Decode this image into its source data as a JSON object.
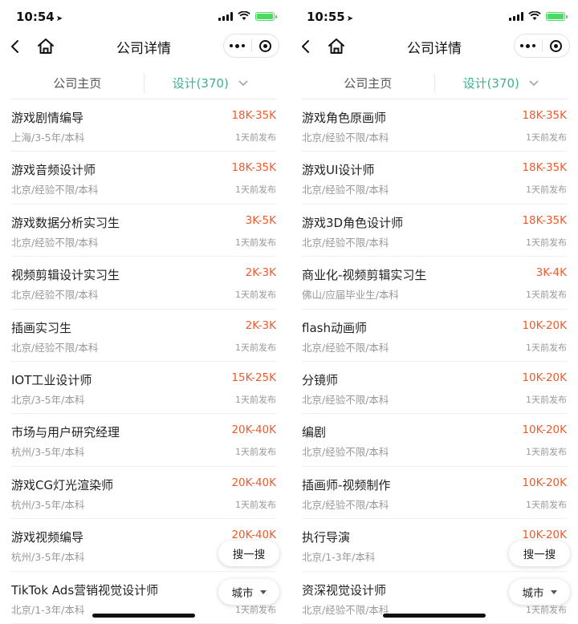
{
  "screens": [
    {
      "status": {
        "time": "10:54"
      },
      "nav": {
        "title": "公司详情"
      },
      "tabs": {
        "home": "公司主页",
        "category": "设计(370)"
      },
      "jobs": [
        {
          "title": "游戏剧情编导",
          "salary": "18K-35K",
          "meta": "上海/3-5年/本科",
          "posted": "1天前发布"
        },
        {
          "title": "游戏音频设计师",
          "salary": "18K-35K",
          "meta": "北京/经验不限/本科",
          "posted": "1天前发布"
        },
        {
          "title": "游戏数据分析实习生",
          "salary": "3K-5K",
          "meta": "北京/经验不限/本科",
          "posted": "1天前发布"
        },
        {
          "title": "视频剪辑设计实习生",
          "salary": "2K-3K",
          "meta": "北京/经验不限/本科",
          "posted": "1天前发布"
        },
        {
          "title": "插画实习生",
          "salary": "2K-3K",
          "meta": "北京/经验不限/本科",
          "posted": "1天前发布"
        },
        {
          "title": "IOT工业设计师",
          "salary": "15K-25K",
          "meta": "北京/3-5年/本科",
          "posted": "1天前发布"
        },
        {
          "title": "市场与用户研究经理",
          "salary": "20K-40K",
          "meta": "杭州/3-5年/本科",
          "posted": "1天前发布"
        },
        {
          "title": "游戏CG灯光渲染师",
          "salary": "20K-40K",
          "meta": "杭州/3-5年/本科",
          "posted": "1天前发布"
        },
        {
          "title": "游戏视频编导",
          "salary": "20K-40K",
          "meta": "杭州/3-5年/本科",
          "posted": ""
        },
        {
          "title": "TikTok Ads营销视觉设计师",
          "salary": "",
          "meta": "北京/1-3年/本科",
          "posted": "1天前发布"
        }
      ],
      "buttons": {
        "search": "搜一搜",
        "city": "城市"
      }
    },
    {
      "status": {
        "time": "10:55"
      },
      "nav": {
        "title": "公司详情"
      },
      "tabs": {
        "home": "公司主页",
        "category": "设计(370)"
      },
      "jobs": [
        {
          "title": "游戏角色原画师",
          "salary": "18K-35K",
          "meta": "北京/经验不限/本科",
          "posted": "1天前发布"
        },
        {
          "title": "游戏UI设计师",
          "salary": "18K-35K",
          "meta": "北京/经验不限/本科",
          "posted": "1天前发布"
        },
        {
          "title": "游戏3D角色设计师",
          "salary": "18K-35K",
          "meta": "北京/经验不限/本科",
          "posted": "1天前发布"
        },
        {
          "title": "商业化-视频剪辑实习生",
          "salary": "3K-4K",
          "meta": "佛山/应届毕业生/本科",
          "posted": "1天前发布"
        },
        {
          "title": "flash动画师",
          "salary": "10K-20K",
          "meta": "北京/经验不限/本科",
          "posted": "1天前发布"
        },
        {
          "title": "分镜师",
          "salary": "10K-20K",
          "meta": "北京/经验不限/本科",
          "posted": "1天前发布"
        },
        {
          "title": "编剧",
          "salary": "10K-20K",
          "meta": "北京/经验不限/本科",
          "posted": "1天前发布"
        },
        {
          "title": "插画师-视频制作",
          "salary": "10K-20K",
          "meta": "北京/经验不限/本科",
          "posted": "1天前发布"
        },
        {
          "title": "执行导演",
          "salary": "10K-20K",
          "meta": "北京/1-3年/本科",
          "posted": ""
        },
        {
          "title": "资深视觉设计师",
          "salary": "",
          "meta": "北京/经验不限/本科",
          "posted": "1天前发布"
        }
      ],
      "buttons": {
        "search": "搜一搜",
        "city": "城市"
      }
    }
  ]
}
